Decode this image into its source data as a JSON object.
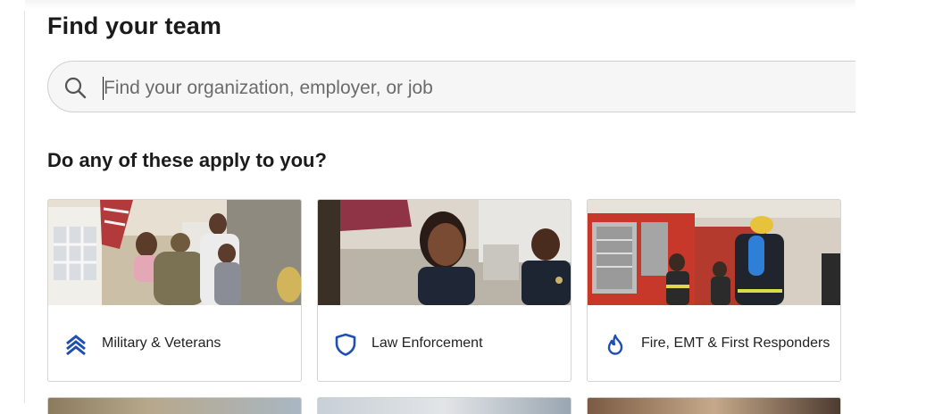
{
  "page": {
    "title": "Find your team",
    "section_title": "Do any of these apply to you?"
  },
  "search": {
    "placeholder": "Find your organization, employer, or job",
    "value": "",
    "icon": "search-icon"
  },
  "categories": [
    {
      "label": "Military & Veterans",
      "icon": "chevrons-up-icon",
      "image": "military-family-reunion-photo"
    },
    {
      "label": "Law Enforcement",
      "icon": "shield-icon",
      "image": "police-officers-smiling-photo"
    },
    {
      "label": "Fire, EMT & First Responders",
      "icon": "flame-icon",
      "image": "firefighters-fire-truck-photo"
    }
  ],
  "colors": {
    "accent": "#1f4fb4",
    "text": "#1f1f1f",
    "search_bg": "#f6f6f6",
    "border": "#d4d4d4"
  }
}
